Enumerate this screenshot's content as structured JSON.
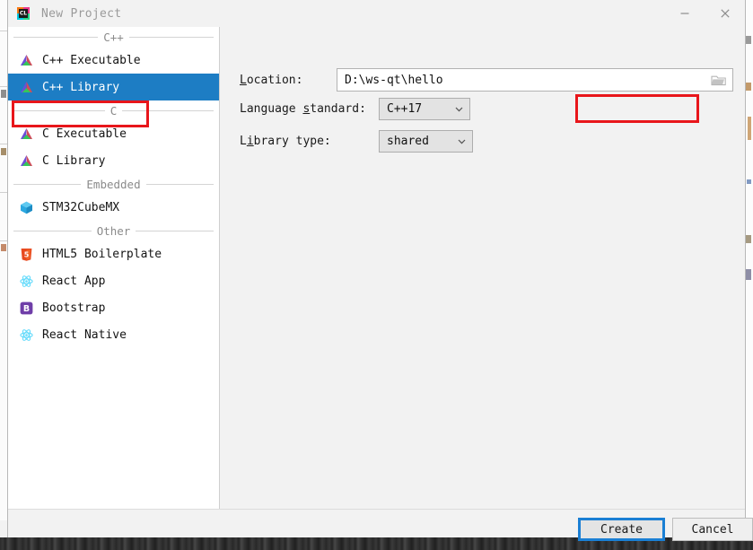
{
  "window": {
    "title": "New Project",
    "app_icon": "clion-icon",
    "controls": [
      {
        "name": "minimize-button",
        "glyph": "minimize-icon"
      },
      {
        "name": "close-button",
        "glyph": "close-icon"
      }
    ]
  },
  "colors": {
    "selection_blue": "#1d7dc4",
    "annotation_red": "#e8161b",
    "focus_blue": "#1a7fd4",
    "panel_grey": "#f2f2f2",
    "list_white": "#ffffff"
  },
  "template_list": {
    "groups": [
      {
        "label": "C++",
        "items": [
          {
            "label": "C++ Executable",
            "icon": "clion-triangle-icon",
            "selected": false
          },
          {
            "label": "C++ Library",
            "icon": "clion-triangle-icon",
            "selected": true
          }
        ]
      },
      {
        "label": "C",
        "items": [
          {
            "label": "C Executable",
            "icon": "clion-triangle-icon",
            "selected": false
          },
          {
            "label": "C Library",
            "icon": "clion-triangle-icon",
            "selected": false
          }
        ]
      },
      {
        "label": "Embedded",
        "items": [
          {
            "label": "STM32CubeMX",
            "icon": "cube-icon",
            "selected": false
          }
        ]
      },
      {
        "label": "Other",
        "items": [
          {
            "label": "HTML5 Boilerplate",
            "icon": "html5-icon",
            "selected": false
          },
          {
            "label": "React App",
            "icon": "react-icon",
            "selected": false
          },
          {
            "label": "Bootstrap",
            "icon": "bootstrap-icon",
            "selected": false
          },
          {
            "label": "React Native",
            "icon": "react-icon",
            "selected": false
          }
        ]
      }
    ]
  },
  "form": {
    "location": {
      "label_pre": "L",
      "label_mnemonic": "",
      "label_post": "ocation:",
      "value": "D:\\ws-qt\\hello",
      "browse_icon": "folder-icon"
    },
    "language_standard": {
      "label_pre": "Language ",
      "label_mnemonic": "s",
      "label_post": "tandard:",
      "value": "C++17"
    },
    "library_type": {
      "label_pre": "L",
      "label_mnemonic": "i",
      "label_post": "brary type:",
      "value": "shared"
    }
  },
  "footer": {
    "create_label": "Create",
    "cancel_label": "Cancel"
  },
  "annotations": [
    {
      "name": "highlight-cpp-library",
      "color": "#e8161b"
    },
    {
      "name": "highlight-library-type",
      "color": "#e8161b"
    }
  ]
}
